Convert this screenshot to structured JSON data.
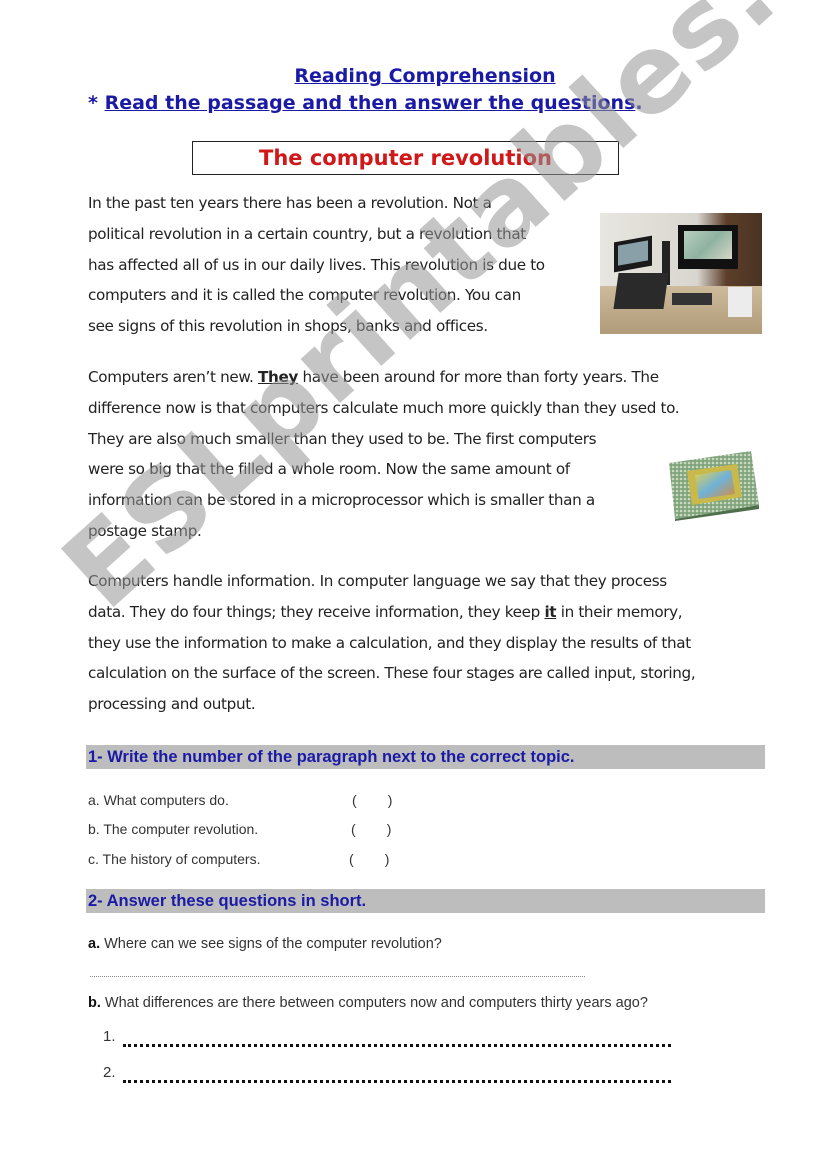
{
  "header": {
    "title": "Reading Comprehension",
    "instruction_prefix": "* ",
    "instruction": "Read the passage and then answer the questions",
    "instruction_suffix": "."
  },
  "passage": {
    "title": "The computer revolution",
    "paragraphs": [
      {
        "lines": [
          "In the past ten years there has been a revolution. Not a",
          "political revolution in a certain country, but a revolution that",
          "has affected all of us in our daily lives. This revolution is due to",
          "computers and it is called the computer revolution. You can",
          "see signs of this revolution in shops, banks and offices."
        ]
      },
      {
        "line1_before": "Computers aren’t new. ",
        "line1_emph": "They",
        "line1_after": " have been around for more than forty years. The",
        "lines": [
          "difference now is that computers calculate much more quickly than they used to.",
          "They are also much smaller than they used to be. The first computers",
          "were so big that the filled a whole room. Now the same amount of",
          "information can be stored in a microprocessor which is smaller than a",
          "postage stamp."
        ]
      },
      {
        "line1": "Computers handle information. In computer language we say that they process",
        "line2_before": "data. They do four things; they receive information, they keep ",
        "line2_emph": "it",
        "line2_after": " in their memory,",
        "lines": [
          "they use the information to make a calculation, and they display the results of that",
          "calculation on the surface of the screen. These four stages are called input, storing,",
          "processing and output."
        ]
      }
    ],
    "images": {
      "computers_alt": "photo-computer-workstation",
      "chip_alt": "photo-microprocessor"
    }
  },
  "exercise1": {
    "heading": "1- Write the number of the paragraph next to the correct topic.",
    "items": [
      {
        "label": "a. What computers do.",
        "blank": "(        )"
      },
      {
        "label": "b. The computer revolution.",
        "blank": "(        )"
      },
      {
        "label": "c. The history of computers.",
        "blank": "(        )"
      }
    ]
  },
  "exercise2": {
    "heading": "2- Answer these questions in short.",
    "question_a_marker": "a.",
    "question_a": " Where can we see signs of the computer revolution?",
    "question_b_marker": "b.",
    "question_b": " What differences are there between computers now and computers thirty years ago?",
    "answer_numbers": [
      "1.",
      "2."
    ]
  },
  "watermark": "ESLprintables.com",
  "colors": {
    "heading_blue": "#1a1aa6",
    "title_red": "#d01818",
    "section_bar_gray": "#bdbdbd"
  }
}
